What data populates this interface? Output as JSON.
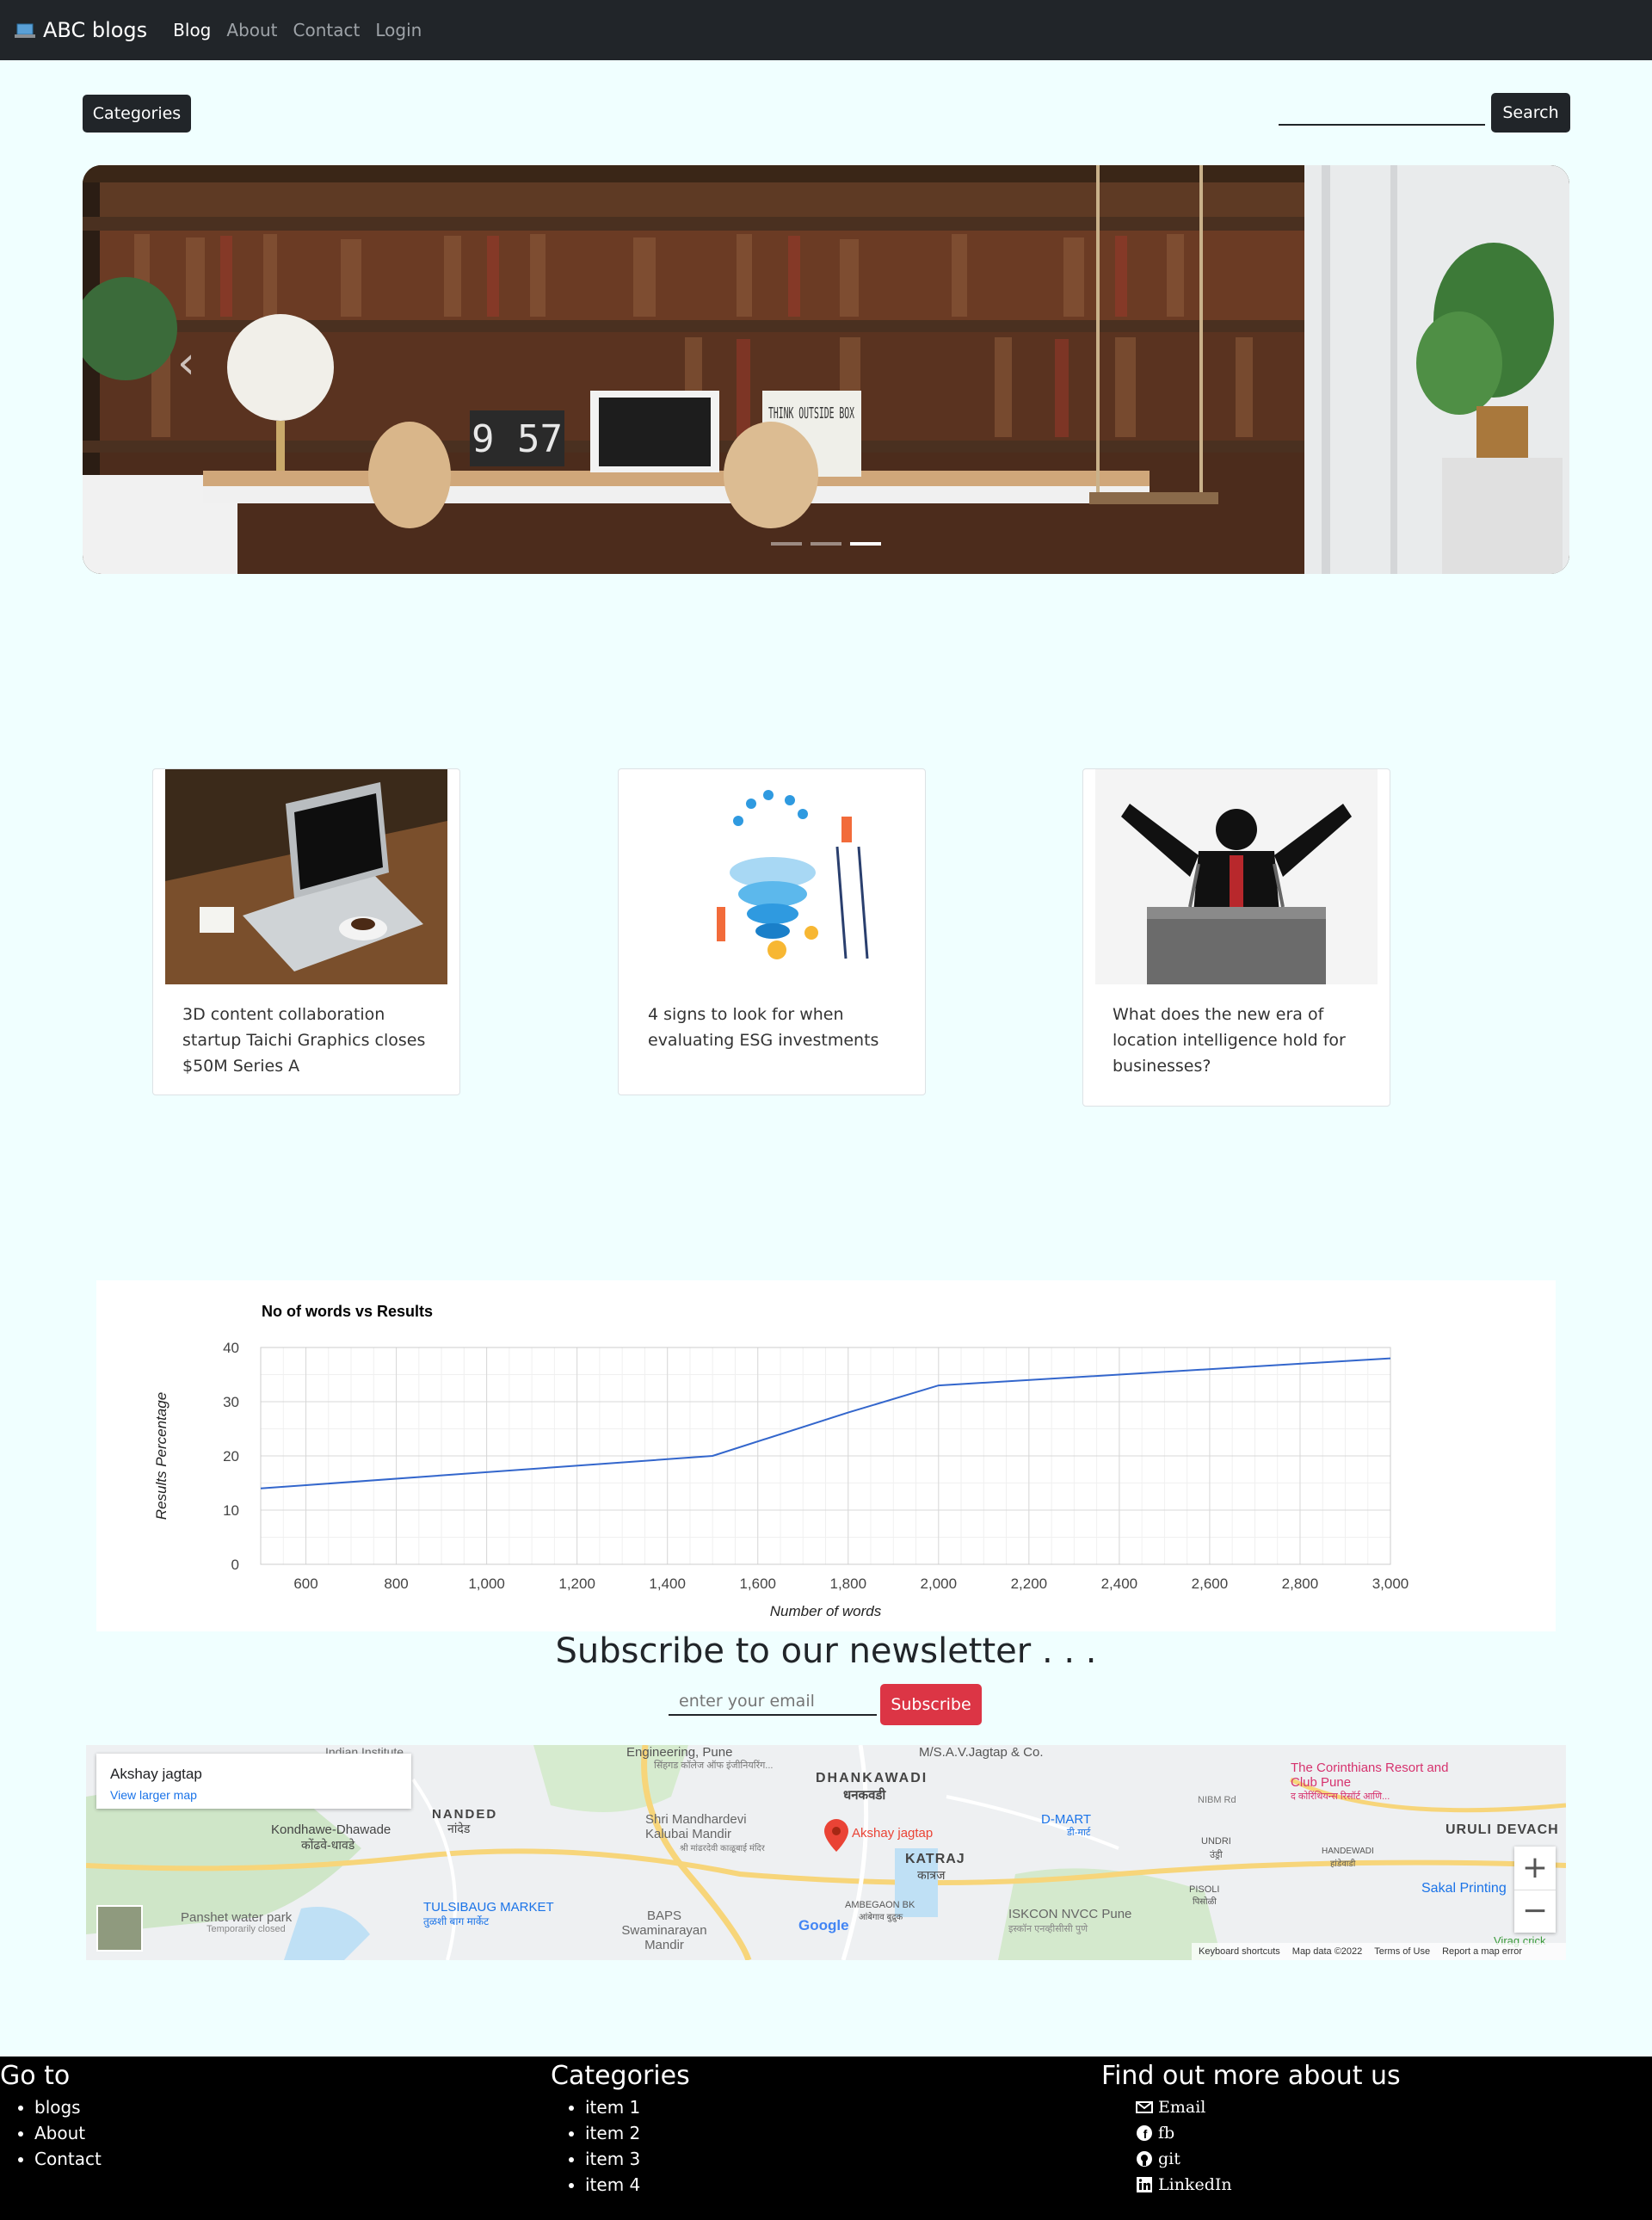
{
  "navbar": {
    "brand": "ABC blogs",
    "links": [
      "Blog",
      "About",
      "Contact",
      "Login"
    ]
  },
  "toolbar": {
    "categories_label": "Categories",
    "search_label": "Search",
    "search_value": ""
  },
  "carousel": {
    "clock_text": "9 57",
    "sign_text": "THINK OUTSIDE BOX",
    "slides": 3,
    "active_slide": 3
  },
  "cards": [
    {
      "title": "3D content collaboration startup Taichi Graphics closes $50M Series A",
      "image": "laptop-on-desk"
    },
    {
      "title": "4 signs to look for when evaluating ESG investments",
      "image": "esg-illustration"
    },
    {
      "title": "What does the new era of location intelligence hold for businesses?",
      "image": "speaker-silhouette"
    }
  ],
  "chart_data": {
    "type": "line",
    "title": "No of words vs Results",
    "xlabel": "Number of words",
    "ylabel": "Results Percentage",
    "x": [
      500,
      1500,
      1800,
      2000,
      3000
    ],
    "series": [
      {
        "values": [
          14,
          20,
          28,
          33,
          38
        ]
      }
    ],
    "xlim": [
      500,
      3000
    ],
    "ylim": [
      0,
      40
    ],
    "xticks": [
      "600",
      "800",
      "1,000",
      "1,200",
      "1,400",
      "1,600",
      "1,800",
      "2,000",
      "2,200",
      "2,400",
      "2,600",
      "2,800",
      "3,000"
    ],
    "yticks": [
      "0",
      "10",
      "20",
      "30",
      "40"
    ],
    "grid": true,
    "color": "#3366cc"
  },
  "newsletter": {
    "title": "Subscribe to our newsletter . . .",
    "placeholder": "enter your email",
    "button": "Subscribe"
  },
  "map": {
    "place_name": "Akshay jagtap",
    "larger_map_link": "View larger map",
    "pin_label": "Akshay jagtap",
    "labels": [
      "Indian Institute",
      "Engineering, Pune",
      "सिंहगड कॉलेज ऑफ इंजीनियरिंग...",
      "M/S.A.V.Jagtap & Co.",
      "DHANKAWADI",
      "धनकवडी",
      "The Corinthians Resort and Club Pune",
      "द कोरिंथियन्स रिसॉर्ट आणि...",
      "NANDED",
      "नांदेड",
      "Kondhawe-Dhawade",
      "कोंढवे-धावडे",
      "Shri Mandhardevi Kalubai Mandir",
      "श्री मांढरदेवी काळूबाई मंदिर",
      "D-MART",
      "डी-मार्ट",
      "NIBM Rd",
      "URULI DEVACH",
      "UNDRI",
      "उंड्री",
      "HANDEWADI",
      "हांडेवाडी",
      "KATRAJ",
      "कात्रज",
      "Sakal Printing",
      "TULSIBAUG MARKET",
      "तुळशी बाग मार्केट",
      "Panshet water park",
      "Temporarily closed",
      "BAPS Swaminarayan Mandir",
      "AMBEGAON BK",
      "आंबेगाव बुद्रुक",
      "ISKCON NVCC Pune",
      "इस्कॉन एनव्हीसीसी पुणे",
      "PISOLI",
      "पिसोळी",
      "Virag crick"
    ],
    "footer_links": [
      "Keyboard shortcuts",
      "Map data ©2022",
      "Terms of Use",
      "Report a map error"
    ],
    "zoom_in": "+",
    "zoom_out": "−"
  },
  "footer": {
    "goto": {
      "title": "Go to",
      "items": [
        "blogs",
        "About",
        "Contact"
      ]
    },
    "categories": {
      "title": "Categories",
      "items": [
        "item 1",
        "item 2",
        "item 3",
        "item 4"
      ]
    },
    "about": {
      "title": "Find out more about us",
      "items": [
        "Email",
        "fb",
        "git",
        "LinkedIn"
      ]
    }
  }
}
